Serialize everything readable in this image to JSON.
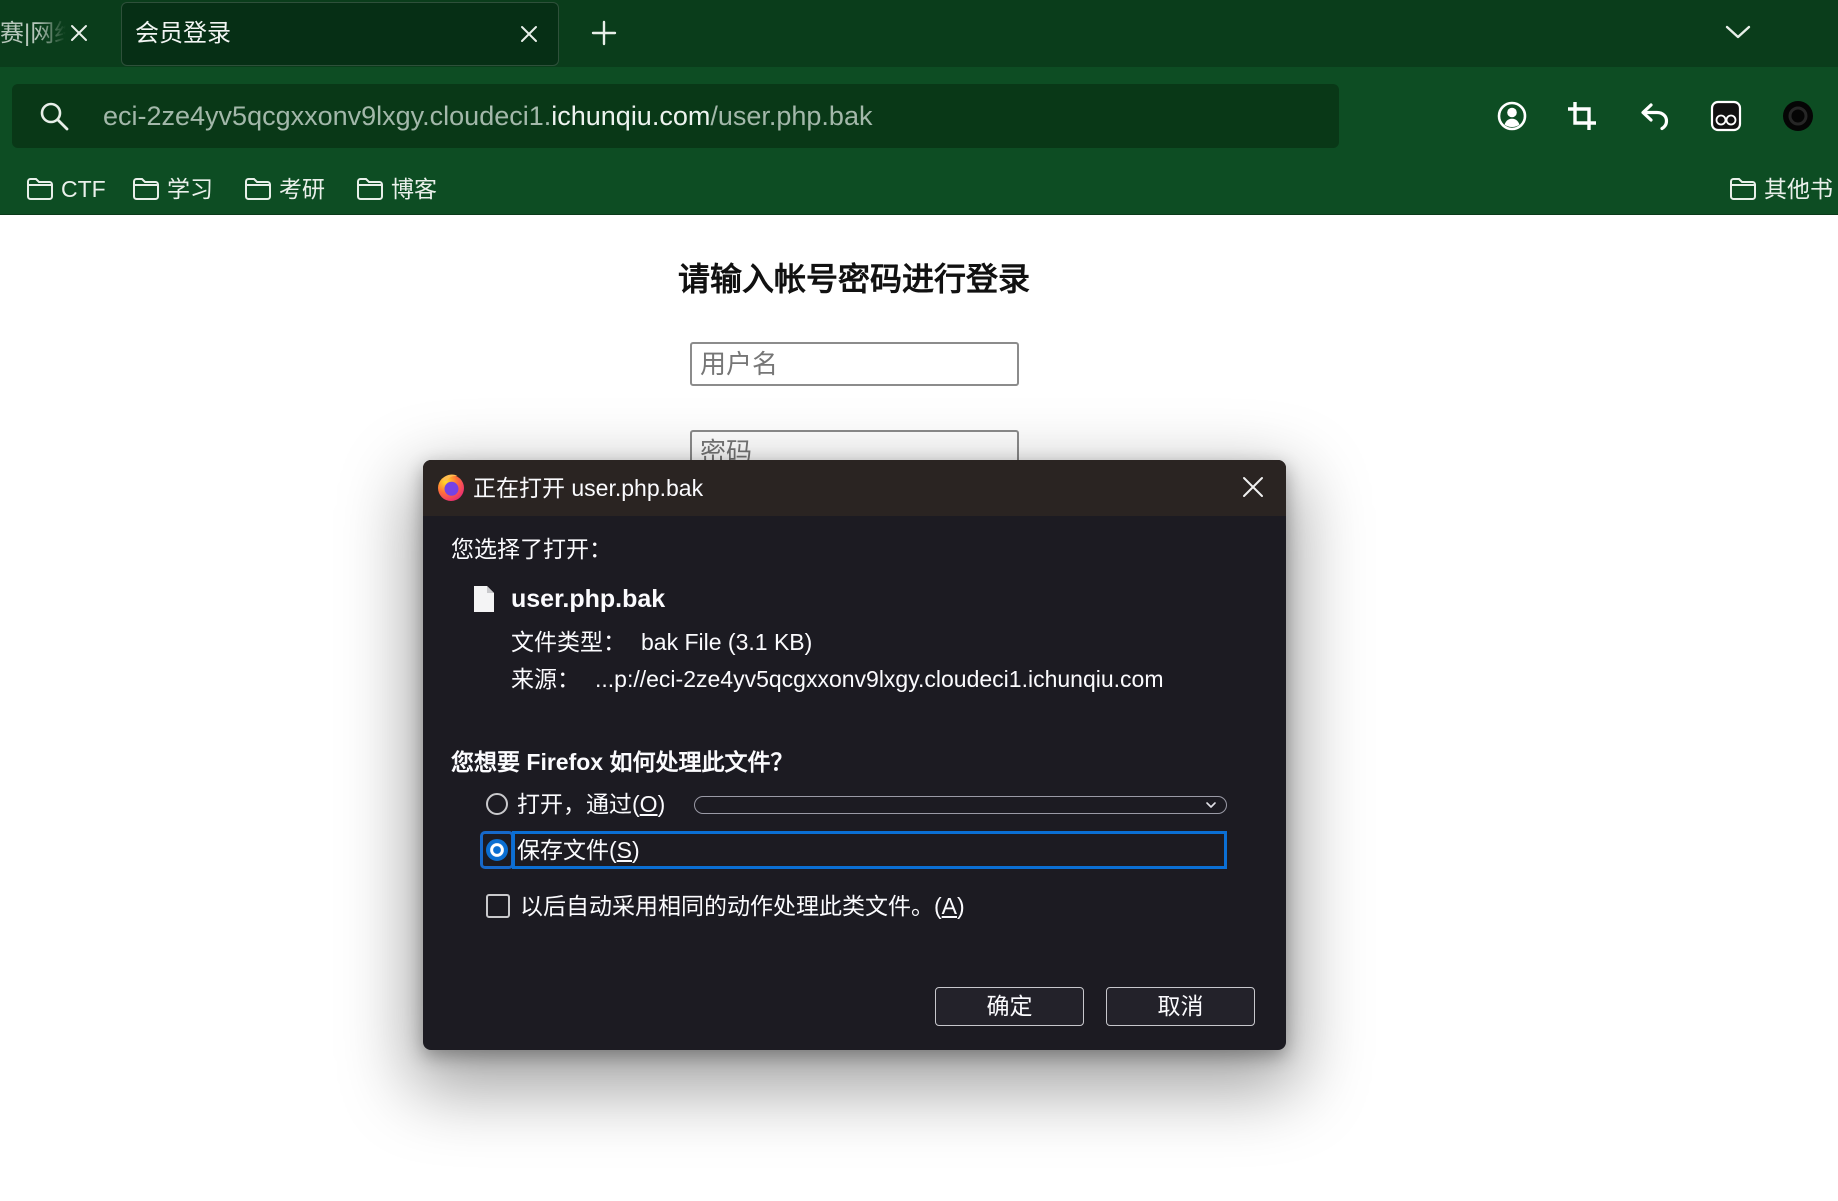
{
  "browser": {
    "tabs": [
      {
        "label": "赛|网络",
        "active": false
      },
      {
        "label": "会员登录",
        "active": true
      }
    ],
    "url": {
      "subdomain": "eci-2ze4yv5qcgxxonv9lxgy.cloudeci1.",
      "domain": "ichunqiu.com",
      "path": "/user.php.bak"
    },
    "toolbar_icons": [
      "account-icon",
      "crop-icon",
      "undo-icon",
      "extension-glasses-icon",
      "record-icon"
    ],
    "bookmarks": [
      {
        "label": "CTF",
        "icon": "folder-icon"
      },
      {
        "label": "学习",
        "icon": "folder-icon"
      },
      {
        "label": "考研",
        "icon": "folder-icon"
      },
      {
        "label": "博客",
        "icon": "folder-icon"
      }
    ],
    "other_bookmarks": {
      "label": "其他书",
      "icon": "folder-icon"
    }
  },
  "page": {
    "heading": "请输入帐号密码进行登录",
    "username": {
      "placeholder": "用户名"
    },
    "password": {
      "placeholder": "密码"
    }
  },
  "dialog": {
    "title": "正在打开 user.php.bak",
    "intro": "您选择了打开：",
    "file": {
      "icon": "file-icon",
      "name": "user.php.bak",
      "type_label": "文件类型：",
      "type_value": "bak File (3.1 KB)",
      "source_label": "来源：",
      "source_value": "...p://eci-2ze4yv5qcgxxonv9lxgy.cloudeci1.ichunqiu.com"
    },
    "question": "您想要 Firefox 如何处理此文件？",
    "options": {
      "open_with": {
        "prefix": "打开，通过(",
        "accesskey": "O",
        "suffix": ")",
        "selected": false
      },
      "save_file": {
        "prefix": "保存文件(",
        "accesskey": "S",
        "suffix": ")",
        "selected": true
      },
      "remember": {
        "prefix": "以后自动采用相同的动作处理此类文件。(",
        "accesskey": "A",
        "suffix": ")",
        "checked": false
      }
    },
    "buttons": {
      "ok": "确定",
      "cancel": "取消"
    }
  },
  "colors": {
    "tabstrip": "#0a3d1b",
    "header": "#0d4d23",
    "urlbar": "#093817",
    "accent": "#0a6ed1",
    "dialog_bg": "#1c1b22",
    "dialog_title": "#2a2422"
  }
}
